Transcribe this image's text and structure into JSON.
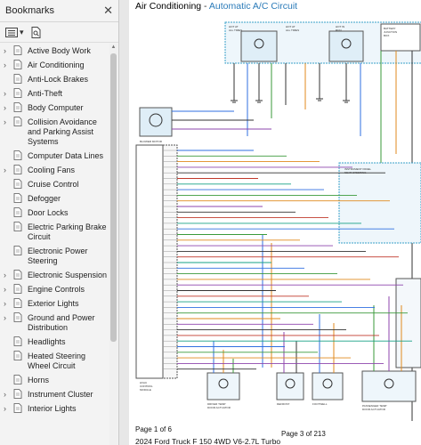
{
  "sidebar": {
    "title": "Bookmarks",
    "items": [
      {
        "label": "Active Body Work",
        "expandable": true
      },
      {
        "label": "Air Conditioning",
        "expandable": true
      },
      {
        "label": "Anti-Lock Brakes",
        "expandable": false
      },
      {
        "label": "Anti-Theft",
        "expandable": true
      },
      {
        "label": "Body Computer",
        "expandable": true
      },
      {
        "label": "Collision Avoidance and Parking Assist Systems",
        "expandable": true
      },
      {
        "label": "Computer Data Lines",
        "expandable": false
      },
      {
        "label": "Cooling Fans",
        "expandable": true
      },
      {
        "label": "Cruise Control",
        "expandable": false
      },
      {
        "label": "Defogger",
        "expandable": false
      },
      {
        "label": "Door Locks",
        "expandable": false
      },
      {
        "label": "Electric Parking Brake Circuit",
        "expandable": false
      },
      {
        "label": "Electronic Power Steering",
        "expandable": false
      },
      {
        "label": "Electronic Suspension",
        "expandable": true
      },
      {
        "label": "Engine Controls",
        "expandable": true
      },
      {
        "label": "Exterior Lights",
        "expandable": true
      },
      {
        "label": "Ground and Power Distribution",
        "expandable": true
      },
      {
        "label": "Headlights",
        "expandable": false
      },
      {
        "label": "Heated Steering Wheel Circuit",
        "expandable": false
      },
      {
        "label": "Horns",
        "expandable": false
      },
      {
        "label": "Instrument Cluster",
        "expandable": true
      },
      {
        "label": "Interior Lights",
        "expandable": true
      }
    ]
  },
  "document": {
    "title": "Air Conditioning",
    "separator": " - ",
    "subtitle": "Automatic A/C Circuit",
    "page_of": "Page 1 of 6",
    "page_total": "Page 3 of 213",
    "vehicle": "2024 Ford Truck F 150 4WD V6-2.7L Turbo"
  },
  "colors": {
    "accent": "#2b7bb9",
    "wire_blue": "#2f6fe0",
    "wire_green": "#3a9a3a",
    "wire_orange": "#e08a1e",
    "wire_purple": "#8e44ad"
  }
}
